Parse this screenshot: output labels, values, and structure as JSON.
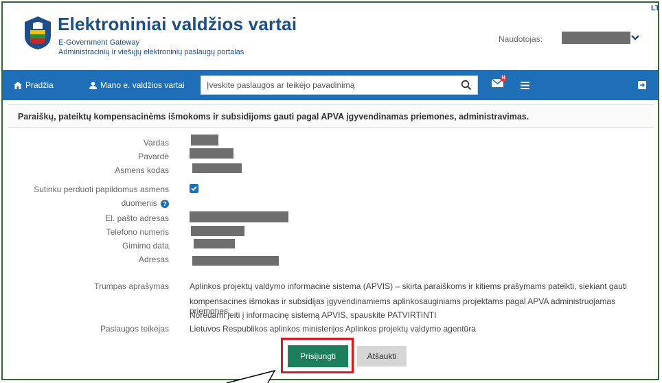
{
  "header": {
    "title": "Elektroniniai valdžios vartai",
    "subtitle_en": "E-Government Gateway",
    "subtitle_lt": "Administracinių ir viešųjų elektroninių paslaugų portalas",
    "user_label": "Naudotojas:",
    "lang": "LT EN"
  },
  "nav": {
    "home": "Pradžia",
    "my_gateway": "Mano e. valdžios vartai",
    "search_placeholder": "Įveskite paslaugos ar teikėjo pavadinimą",
    "messages_badge": "N"
  },
  "page": {
    "heading": "Paraiškų, pateiktų kompensacinėms išmokoms ir subsidijoms gauti pagal APVA įgyvendinamas priemones, administravimas."
  },
  "form": {
    "first_name_label": "Vardas",
    "last_name_label": "Pavardė",
    "personal_code_label": "Asmens kodas",
    "consent_label_1": "Sutinku perduoti papildomus asmens",
    "consent_label_2": "duomenis",
    "email_label": "El. pašto adresas",
    "phone_label": "Telefono numeris",
    "birth_date_label": "Gimimo data",
    "address_label": "Adresas",
    "short_desc_label": "Trumpas aprašymas",
    "short_desc_line1": "Aplinkos projektų valdymo informacinė sistema (APVIS) – skirta paraiškoms ir kitiems prašymams pateikti, siekiant gauti",
    "short_desc_line2": "kompensacines išmokas ir subsidijas įgyvendinamiems aplinkosauginiams projektams pagal APVA administruojamas priemones.",
    "short_desc_line3": "Norėdami jeiti į informacinę sistemą APVIS, spauskite PATVIRTINTI",
    "provider_label": "Paslaugos teikėjas",
    "provider_value": "Lietuvos Respublikos aplinkos ministerijos Aplinkos projektų valdymo agentūra"
  },
  "buttons": {
    "login": "Prisijungti",
    "cancel": "Atšaukti"
  },
  "colors": {
    "brand_blue": "#1e6fb7",
    "title_blue": "#1a4f8b",
    "primary_green": "#1b7f5e",
    "highlight_red": "#e0161f",
    "frame_green": "#2f6b2f"
  }
}
